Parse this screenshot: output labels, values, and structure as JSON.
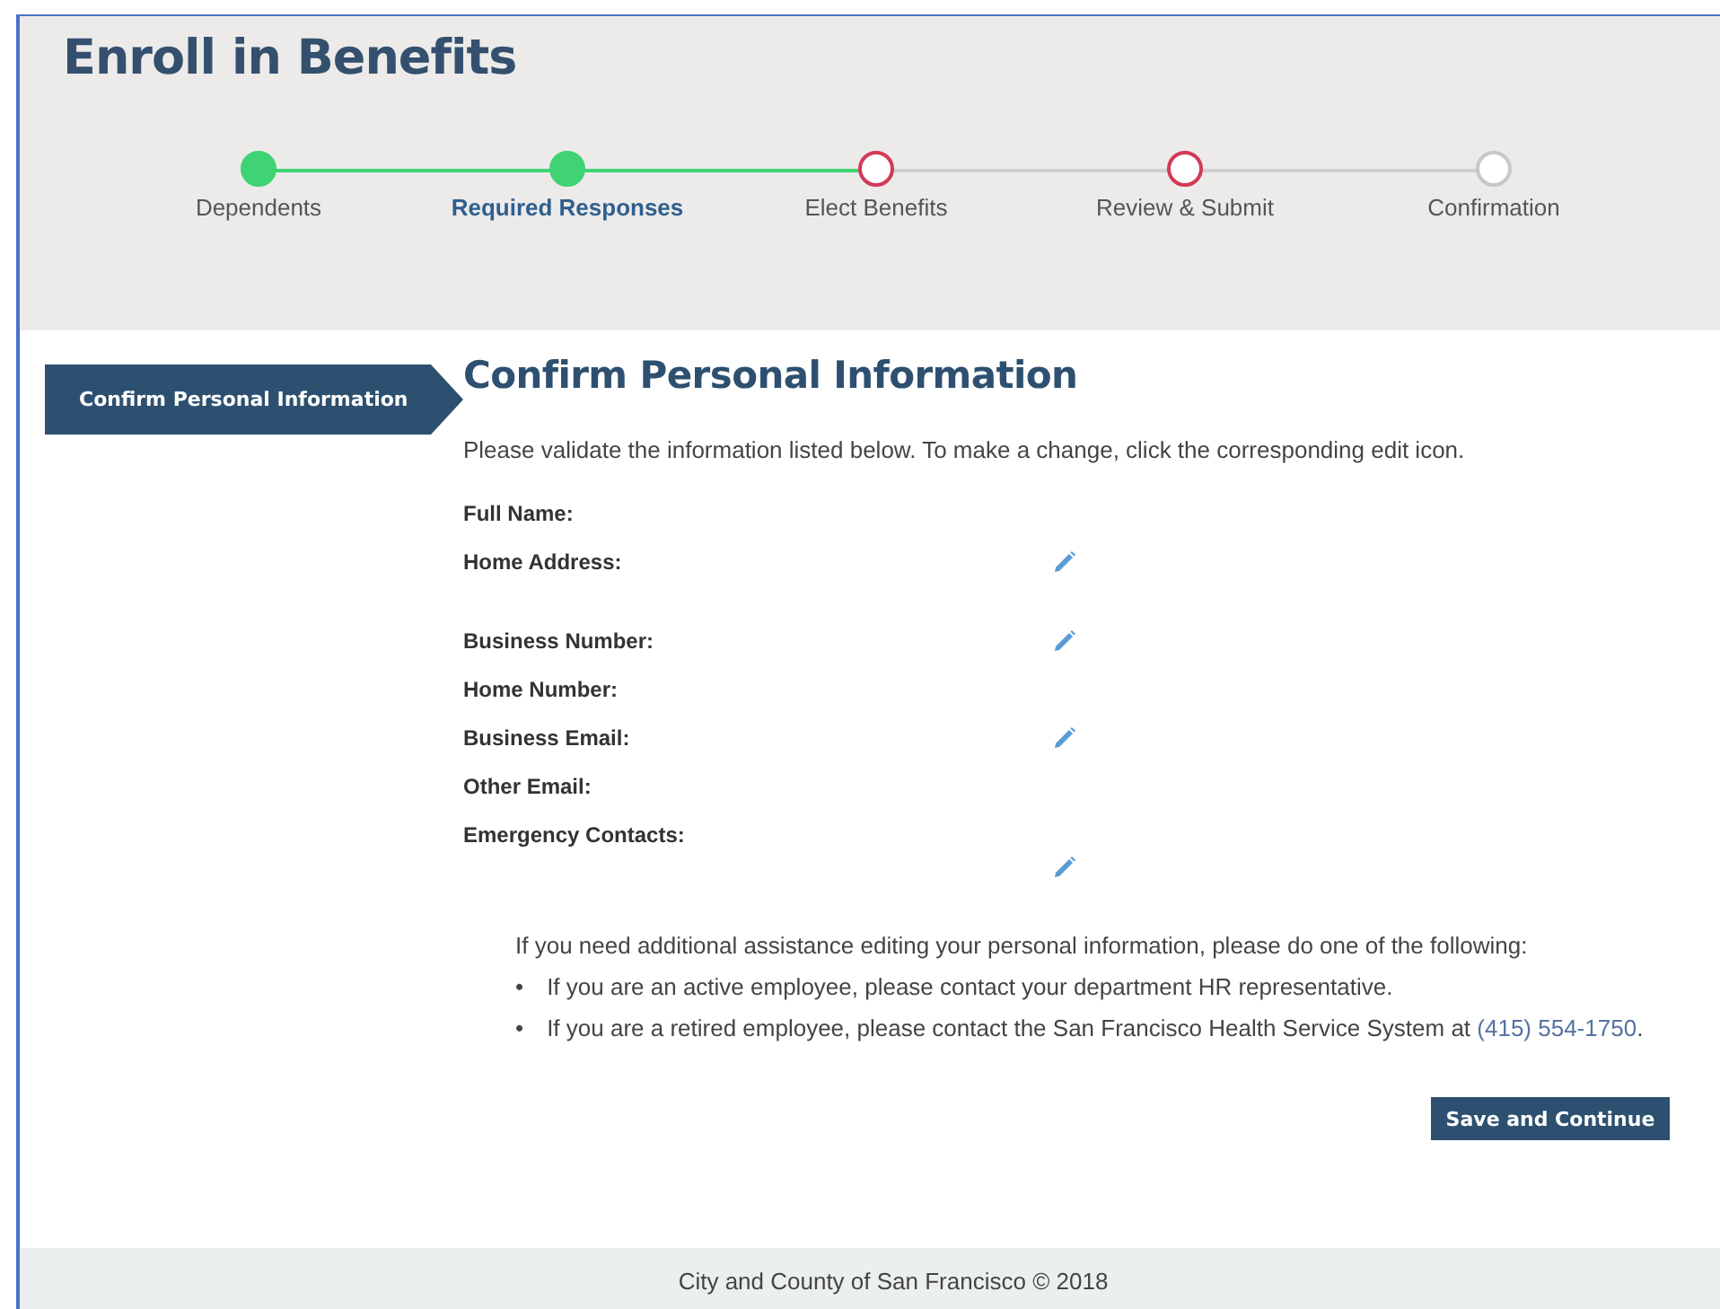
{
  "page_title": "Enroll in Benefits",
  "steps": [
    {
      "label": "Dependents",
      "kind": "done",
      "selected": false
    },
    {
      "label": "Required Responses",
      "kind": "done",
      "selected": true
    },
    {
      "label": "Elect Benefits",
      "kind": "error",
      "selected": false
    },
    {
      "label": "Review & Submit",
      "kind": "error",
      "selected": false
    },
    {
      "label": "Confirmation",
      "kind": "todo",
      "selected": false
    }
  ],
  "sidebar": {
    "items": [
      {
        "label": "Confirm Personal Information",
        "selected": true
      }
    ]
  },
  "content": {
    "title": "Confirm Personal Information",
    "intro": "Please validate the information listed below. To make a change, click the corresponding edit icon.",
    "fields": [
      {
        "label": "Full Name:",
        "editable": false,
        "kind": "single"
      },
      {
        "label": "Home Address:",
        "editable": true,
        "kind": "address"
      },
      {
        "label": "Business Number:",
        "editable": true,
        "kind": "single"
      },
      {
        "label": "Home Number:",
        "editable": false,
        "kind": "single"
      },
      {
        "label": "Business Email:",
        "editable": true,
        "kind": "single"
      },
      {
        "label": "Other Email:",
        "editable": false,
        "kind": "single"
      },
      {
        "label": "Emergency Contacts:",
        "editable": true,
        "kind": "list"
      }
    ],
    "help": {
      "lead": "If you need additional assistance editing your personal information, please do one of the following:",
      "bullets": [
        {
          "marker": "•",
          "text": "If you are an active employee, please contact your department HR representative."
        },
        {
          "marker": "•",
          "text": "If you are a retired employee, please contact the San Francisco Health Service System at ",
          "link": "(415) 554-1750",
          "after": "."
        }
      ]
    },
    "button": "Save and Continue"
  },
  "footer": "City and County of San Francisco © 2018"
}
